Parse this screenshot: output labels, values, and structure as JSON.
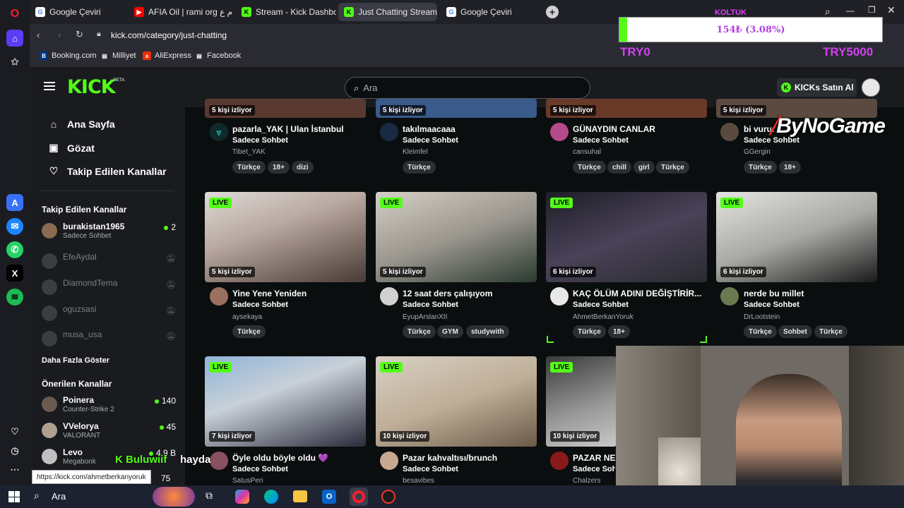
{
  "browser": {
    "tabs": [
      {
        "label": "Google Çeviri",
        "fav": "G",
        "favColor": "#4285f4"
      },
      {
        "label": "AFIA Oil | rami org اعدام ع",
        "fav": "▶",
        "favColor": "#ff0000"
      },
      {
        "label": "Stream - Kick Dashboard",
        "fav": "K",
        "favColor": "#53fc18"
      },
      {
        "label": "Just Chatting Streaming -",
        "fav": "K",
        "favColor": "#53fc18"
      },
      {
        "label": "Google Çeviri",
        "fav": "G",
        "favColor": "#4285f4"
      }
    ],
    "new_tab": "+",
    "url": "kick.com/category/just-chatting",
    "bookmarks": [
      {
        "label": "Booking.com",
        "fav": "B",
        "favColor": "#003580"
      },
      {
        "label": "Milliyet",
        "fav": "▤",
        "favColor": "#ffffff"
      },
      {
        "label": "AliExpress",
        "fav": "a",
        "favColor": "#e62e04"
      },
      {
        "label": "Facebook",
        "fav": "▤",
        "favColor": "#ffffff"
      }
    ],
    "status_url": "https://kick.com/ahmetberkanyoruk"
  },
  "overlay": {
    "label_top": "KOLTUK",
    "progress_text": "154₺ (3.08%)",
    "progress_fraction": 0.0308,
    "min_label": "TRY0",
    "max_label": "TRY5000",
    "brand": "ByNoGame",
    "ticker_name": "Buluwiif",
    "ticker_word": "hayda"
  },
  "kick": {
    "logo": "KICK",
    "logo_sup": "BETA",
    "search_placeholder": "Ara",
    "buy_kicks": "KICKs Satın Al",
    "nav": [
      {
        "label": "Ana Sayfa",
        "icon": "⌂"
      },
      {
        "label": "Gözat",
        "icon": "▣"
      },
      {
        "label": "Takip Edilen Kanallar",
        "icon": "♡"
      }
    ],
    "followed_head": "Takip Edilen Kanallar",
    "followed": [
      {
        "name": "burakistan1965",
        "category": "Sadece Sohbet",
        "viewers": "2",
        "online": true
      },
      {
        "name": "EfeAydal",
        "online": false
      },
      {
        "name": "DiamondTema",
        "online": false
      },
      {
        "name": "oguzsasi",
        "online": false
      },
      {
        "name": "musa_usa",
        "online": false
      }
    ],
    "show_more": "Daha Fazla Göster",
    "recommended_head": "Önerilen Kanallar",
    "recommended": [
      {
        "name": "Poinera",
        "category": "Counter-Strike 2",
        "viewers": "140"
      },
      {
        "name": "VVelorya",
        "category": "VALORANT",
        "viewers": "45"
      },
      {
        "name": "Levo",
        "category": "Megabonk",
        "viewers": "4,9 B"
      }
    ],
    "recommended_extra_count": "75",
    "live_label": "LIVE",
    "row1": [
      {
        "viewers": "5 kişi izliyor",
        "title": "pazarla_YAK | Ulan İstanbul",
        "category": "Sadece Sohbet",
        "channel": "Tibet_YAK",
        "tags": [
          "Türkçe",
          "18+",
          "dizi"
        ],
        "avColor": "#1e7a7a"
      },
      {
        "viewers": "5 kişi izliyor",
        "title": "takılmaacaaa",
        "category": "Sadece Sohbet",
        "channel": "Kleimfel",
        "tags": [
          "Türkçe"
        ],
        "avColor": "#2a3a55"
      },
      {
        "viewers": "5 kişi izliyor",
        "title": "GÜNAYDIN CANLAR",
        "category": "Sadece Sohbet",
        "channel": "cansuhal",
        "tags": [
          "Türkçe",
          "chill",
          "girl",
          "Türkçe"
        ],
        "avColor": "#b54a8a"
      },
      {
        "viewers": "5 kişi izliyor",
        "title": "bi vurur",
        "category": "Sadece Sohbet",
        "channel": "GGergin",
        "tags": [
          "Türkçe",
          "18+"
        ],
        "avColor": "#5a4a40"
      }
    ],
    "row2": [
      {
        "viewers": "5 kişi izliyor",
        "title": "Yine Yene Yeniden",
        "category": "Sadece Sohbet",
        "channel": "aysekaya",
        "tags": [
          "Türkçe"
        ],
        "avColor": "#9a7060",
        "thumb": [
          "#d9d3cf",
          "#6a5a55"
        ]
      },
      {
        "viewers": "5 kişi izliyor",
        "title": "12 saat ders çalışıyom",
        "category": "Sadece Sohbet",
        "channel": "EyupArslanXII",
        "tags": [
          "Türkçe",
          "GYM",
          "studywith"
        ],
        "avColor": "#d0d0d0",
        "thumb": [
          "#c9c6bf",
          "#3a3a3a"
        ]
      },
      {
        "viewers": "6 kişi izliyor",
        "title": "KAÇ ÖLÜM ADINI DEĞİŞTİRİR...",
        "category": "Sadece Sohbet",
        "channel": "AhmetBerkanYoruk",
        "tags": [
          "Türkçe",
          "18+"
        ],
        "avColor": "#e8e8e8",
        "thumb": [
          "#2a2a35",
          "#6a5a70"
        ]
      },
      {
        "viewers": "6 kişi izliyor",
        "title": "nerde bu millet",
        "category": "Sadece Sohbet",
        "channel": "DrLootstein",
        "tags": [
          "Türkçe",
          "Sohbet",
          "Türkçe"
        ],
        "avColor": "#6a7a50",
        "thumb": [
          "#d8d8d4",
          "#2a2a2a"
        ]
      }
    ],
    "row3": [
      {
        "viewers": "7 kişi izliyor",
        "title": "Öyle oldu böyle oldu 💜",
        "category": "Sadece Sohbet",
        "channel": "SatusPeri",
        "avColor": "#8a5060",
        "thumb": [
          "#8fb4d8",
          "#2a2a3a"
        ]
      },
      {
        "viewers": "10 kişi izliyor",
        "title": "Pazar kahvaltısı/brunch",
        "category": "Sadece Sohbet",
        "channel": "besavibes",
        "avColor": "#c8a890",
        "thumb": [
          "#d8d0c4",
          "#8a6a50"
        ]
      },
      {
        "viewers": "10 kişi izliyor",
        "title": "PAZAR NES",
        "category": "Sadece Soh",
        "channel": "Chalzers",
        "avColor": "#8a1a1a",
        "thumb": [
          "#3a3a3a",
          "#c8c8c8"
        ]
      }
    ]
  },
  "taskbar": {
    "search": "Ara"
  }
}
